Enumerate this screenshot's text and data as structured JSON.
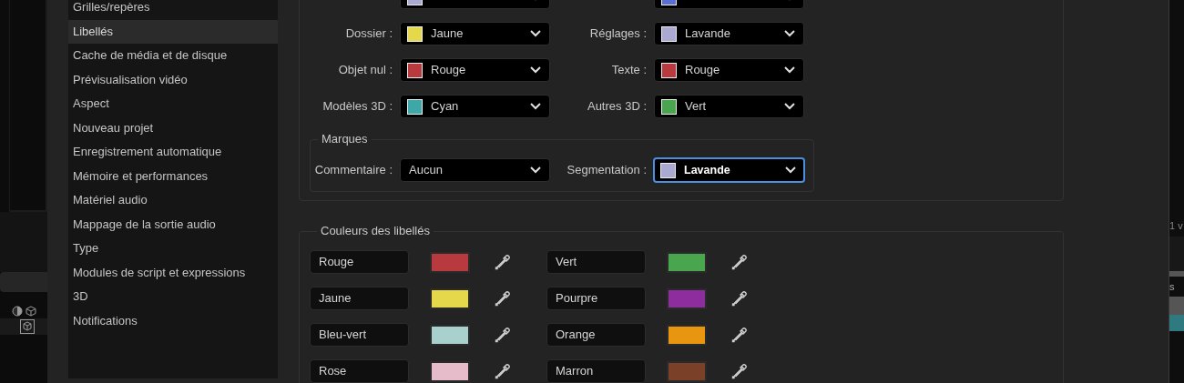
{
  "sidebar": {
    "items": [
      {
        "label": "Grilles/repères",
        "selected": false
      },
      {
        "label": "Libellés",
        "selected": true
      },
      {
        "label": "Cache de média et de disque",
        "selected": false
      },
      {
        "label": "Prévisualisation vidéo",
        "selected": false
      },
      {
        "label": "Aspect",
        "selected": false
      },
      {
        "label": "Nouveau projet",
        "selected": false
      },
      {
        "label": "Enregistrement automatique",
        "selected": false
      },
      {
        "label": "Mémoire et performances",
        "selected": false
      },
      {
        "label": "Matériel audio",
        "selected": false
      },
      {
        "label": "Mappage de la sortie audio",
        "selected": false
      },
      {
        "label": "Type",
        "selected": false
      },
      {
        "label": "Modules de script et expressions",
        "selected": false
      },
      {
        "label": "3D",
        "selected": false
      },
      {
        "label": "Notifications",
        "selected": false
      }
    ]
  },
  "label_defaults": {
    "fields": [
      {
        "color": "#a9a9d1"
      },
      {
        "color": "#5a6ed6"
      },
      {
        "label": "Dossier :",
        "value": "Jaune",
        "color": "#e5d84a"
      },
      {
        "label": "Réglages :",
        "value": "Lavande",
        "color": "#a9a9d1"
      },
      {
        "label": "Objet nul :",
        "value": "Rouge",
        "color": "#b83a3e"
      },
      {
        "label": "Texte :",
        "value": "Rouge",
        "color": "#b83a3e"
      },
      {
        "label": "Modèles 3D :",
        "value": "Cyan",
        "color": "#3ea7a8"
      },
      {
        "label": "Autres 3D :",
        "value": "Vert",
        "color": "#4aa64e"
      }
    ],
    "markers": {
      "title": "Marques",
      "fields": [
        {
          "label": "Commentaire :",
          "value": "Aucun",
          "focused": false
        },
        {
          "label": "Segmentation :",
          "value": "Lavande",
          "color": "#a9a9d1",
          "focused": true
        }
      ]
    }
  },
  "label_colors": {
    "title": "Couleurs des libellés",
    "items": [
      {
        "name": "Rouge",
        "color": "#b83a3e"
      },
      {
        "name": "Vert",
        "color": "#4aa64e"
      },
      {
        "name": "Jaune",
        "color": "#e5d84a"
      },
      {
        "name": "Pourpre",
        "color": "#8e2e9e"
      },
      {
        "name": "Bleu-vert",
        "color": "#a8d0cc"
      },
      {
        "name": "Orange",
        "color": "#e8950f"
      },
      {
        "name": "Rose",
        "color": "#e6bccb"
      },
      {
        "name": "Marron",
        "color": "#7a4128"
      }
    ]
  },
  "right_edge": {
    "texts": [
      "1 v",
      "s"
    ]
  }
}
